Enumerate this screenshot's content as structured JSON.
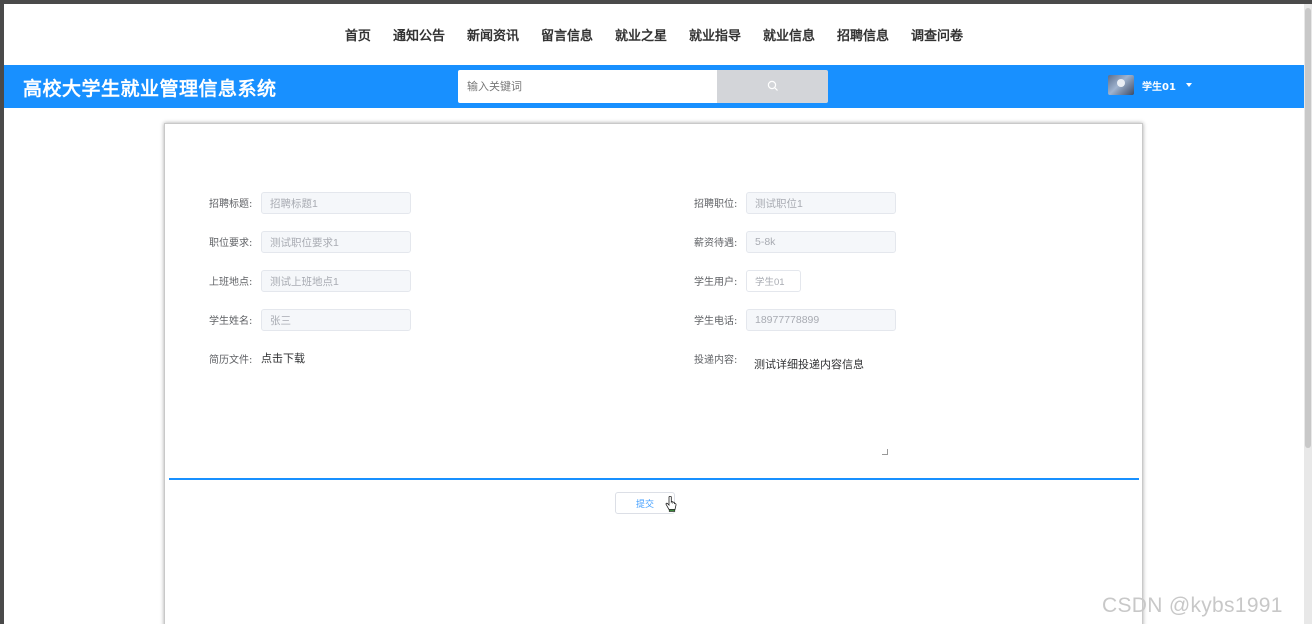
{
  "nav": {
    "items": [
      "首页",
      "通知公告",
      "新闻资讯",
      "留言信息",
      "就业之星",
      "就业指导",
      "就业信息",
      "招聘信息",
      "调查问卷"
    ]
  },
  "header": {
    "title": "高校大学生就业管理信息系统",
    "search_placeholder": "输入关键词",
    "search_icon": "search-icon",
    "user_name": "学生01",
    "brand_color": "#1890ff"
  },
  "form": {
    "left": [
      {
        "label": "招聘标题:",
        "value": "招聘标题1"
      },
      {
        "label": "职位要求:",
        "value": "测试职位要求1"
      },
      {
        "label": "上班地点:",
        "value": "测试上班地点1"
      },
      {
        "label": "学生姓名:",
        "value": "张三"
      }
    ],
    "resume": {
      "label": "简历文件:",
      "link": "点击下载"
    },
    "right": [
      {
        "label": "招聘职位:",
        "value": "测试职位1"
      },
      {
        "label": "薪资待遇:",
        "value": "5-8k"
      },
      {
        "label": "学生用户:",
        "value": "学生01"
      },
      {
        "label": "学生电话:",
        "value": "18977778899"
      }
    ],
    "content": {
      "label": "投递内容:",
      "value": "测试详细投递内容信息"
    },
    "submit_label": "提交"
  },
  "watermark": "CSDN @kybs1991"
}
